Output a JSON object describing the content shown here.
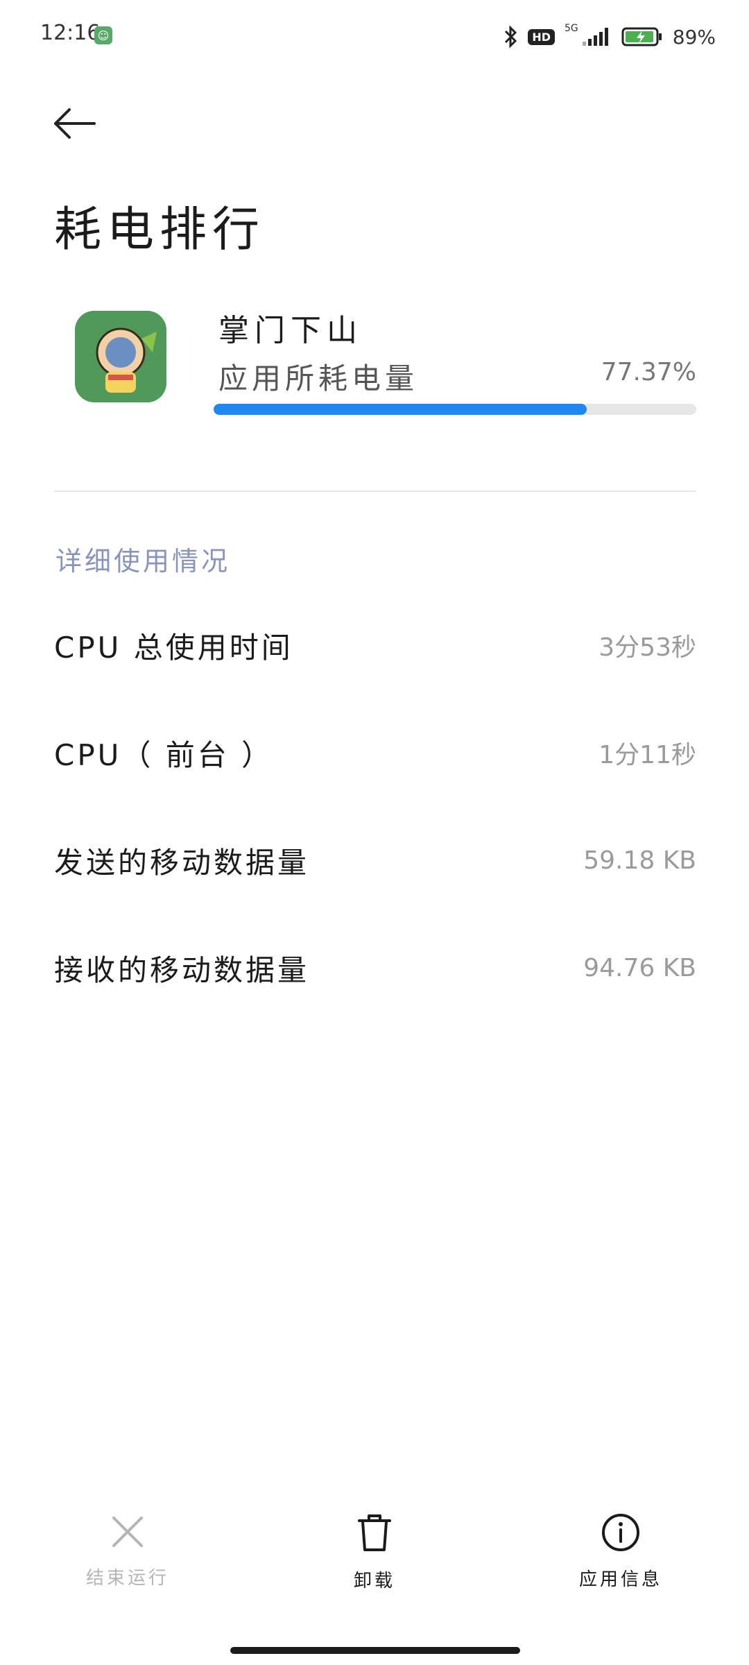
{
  "status_bar": {
    "time": "12:16",
    "hd": "HD",
    "network": "5G",
    "battery_percent": "89%"
  },
  "page": {
    "title": "耗电排行"
  },
  "app": {
    "name": "掌门下山",
    "usage_label": "应用所耗电量",
    "usage_percent": "77.37%",
    "usage_fraction": 0.7737
  },
  "details": {
    "header": "详细使用情况",
    "rows": [
      {
        "label": "CPU 总使用时间",
        "value": "3分53秒"
      },
      {
        "label": "CPU（ 前台 ）",
        "value": "1分11秒"
      },
      {
        "label": "发送的移动数据量",
        "value": "59.18 KB"
      },
      {
        "label": "接收的移动数据量",
        "value": "94.76 KB"
      }
    ]
  },
  "actions": {
    "stop": "结束运行",
    "uninstall": "卸载",
    "info": "应用信息"
  },
  "colors": {
    "accent": "#1e88f0",
    "section_header": "#8a94b8",
    "disabled": "#b5b5b5"
  },
  "icons": {
    "back": "arrow-left-icon",
    "stop": "close-icon",
    "uninstall": "trash-icon",
    "info": "info-icon"
  }
}
